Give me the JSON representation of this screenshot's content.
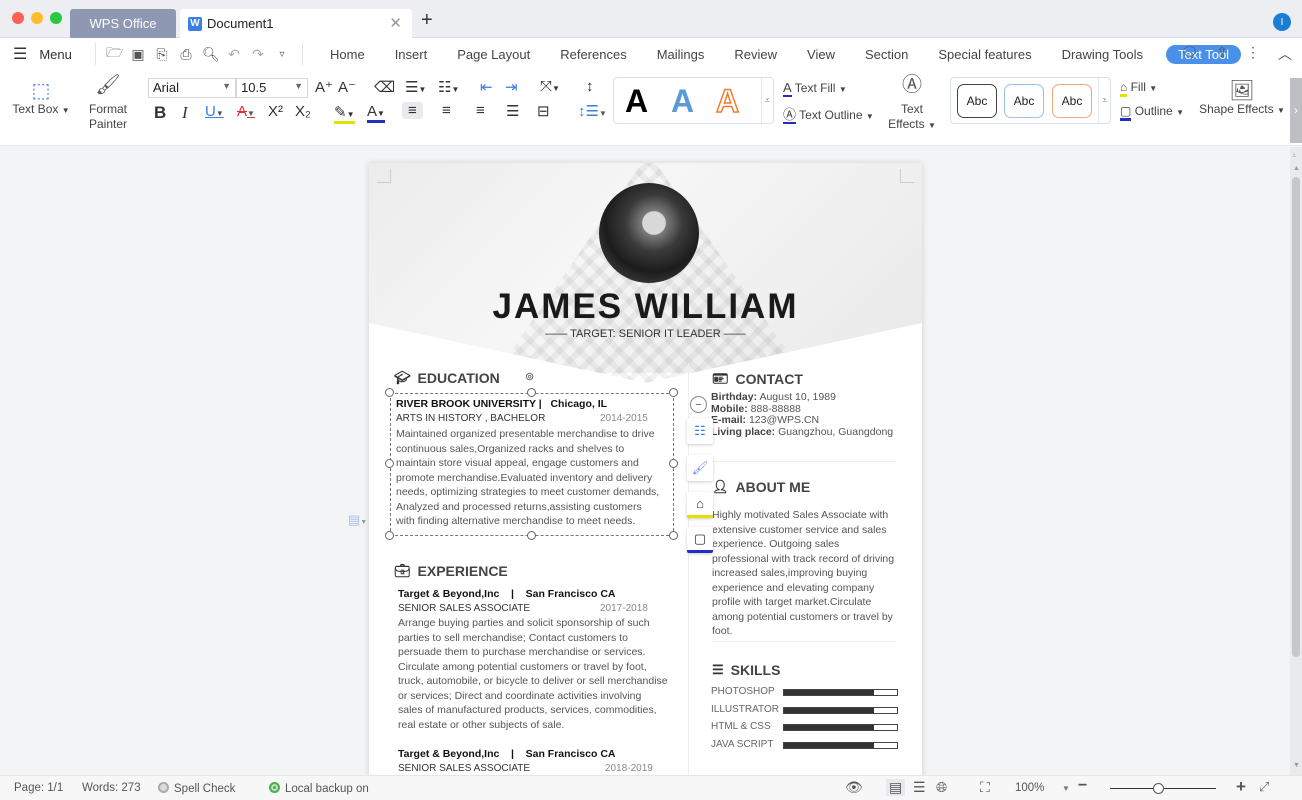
{
  "window": {
    "tabs": [
      {
        "label": "WPS Office"
      },
      {
        "label": "Document1"
      }
    ],
    "doc_icon": "W",
    "user_initial": "I"
  },
  "menubar": {
    "menu_label": "Menu",
    "ribbon_tabs": [
      "Home",
      "Insert",
      "Page Layout",
      "References",
      "Mailings",
      "Review",
      "View",
      "Section",
      "Special features",
      "Drawing Tools",
      "Text Tool"
    ],
    "active_tab": "Text Tool"
  },
  "toolbar": {
    "text_box": "Text Box",
    "format_painter_1": "Format",
    "format_painter_2": "Painter",
    "font_name": "Arial",
    "font_size": "10.5",
    "text_fill": "Text Fill",
    "text_outline": "Text Outline",
    "text_effects_1": "Text",
    "text_effects_2": "Effects",
    "shape_style_label": "Abc",
    "fill": "Fill",
    "outline": "Outline",
    "shape_effects": "Shape Effects",
    "wordart_A": "A",
    "colors": {
      "accent": "#4a90e8",
      "wordart_blue": "#5b9bd5",
      "wordart_orange": "#ed7d31",
      "highlight": "#e6e000",
      "font_color": "#1f2fbf"
    }
  },
  "resume": {
    "name": "JAMES WILLIAM",
    "target": "—— TARGET: SENIOR IT LEADER ——",
    "education": {
      "heading": "EDUCATION",
      "school": "RIVER BROOK UNIVERSITY |",
      "location": "Chicago, IL",
      "degree": "ARTS IN HISTORY , BACHELOR",
      "years": "2014-2015",
      "desc": "Maintained organized presentable merchandise to drive continuous sales,Organized racks and shelves to maintain store visual appeal, engage customers and promote merchandise.Evaluated inventory and delivery needs, optimizing strategies to meet customer demands, Analyzed and processed returns,assisting customers with finding alternative merchandise to meet needs."
    },
    "experience": {
      "heading": "EXPERIENCE",
      "jobs": [
        {
          "company": "Target & Beyond,Inc",
          "sep": "|",
          "location": "San Francisco CA",
          "title": "SENIOR SALES ASSOCIATE",
          "years": "2017-2018",
          "desc": "Arrange buying parties and solicit sponsorship of such parties to sell merchandise; Contact customers to persuade them to purchase merchandise or services. Circulate among potential customers or travel by foot, truck, automobile, or bicycle to deliver or sell merchandise or services; Direct and coordinate activities involving sales of manufactured products, services, commodities, real estate or other subjects of sale."
        },
        {
          "company": "Target & Beyond,Inc",
          "sep": "|",
          "location": "San Francisco CA",
          "title": "SENIOR SALES ASSOCIATE",
          "years": "2018-2019"
        }
      ]
    },
    "contact": {
      "heading": "CONTACT",
      "items": [
        {
          "label": "Birthday:",
          "value": "August 10, 1989"
        },
        {
          "label": "Mobile:",
          "value": "888-88888"
        },
        {
          "label": "E-mail:",
          "value": "123@WPS.CN"
        },
        {
          "label": "Living place:",
          "value": "Guangzhou, Guangdong"
        }
      ]
    },
    "about": {
      "heading": "ABOUT ME",
      "text": "Highly motivated Sales Associate with extensive customer service and sales experience. Outgoing sales professional with track record of driving increased sales,improving buying experience and elevating company profile with target market.Circulate among potential customers or travel by foot."
    },
    "skills": {
      "heading": "SKILLS",
      "items": [
        {
          "name": "PHOTOSHOP",
          "level": 0.8
        },
        {
          "name": "ILLUSTRATOR",
          "level": 0.8
        },
        {
          "name": "HTML & CSS",
          "level": 0.8
        },
        {
          "name": "JAVA SCRIPT",
          "level": 0.8
        }
      ]
    }
  },
  "statusbar": {
    "page": "Page: 1/1",
    "words": "Words: 273",
    "spell_check": "Spell Check",
    "backup": "Local backup on",
    "zoom": "100%",
    "zoom_level": 0.45
  }
}
